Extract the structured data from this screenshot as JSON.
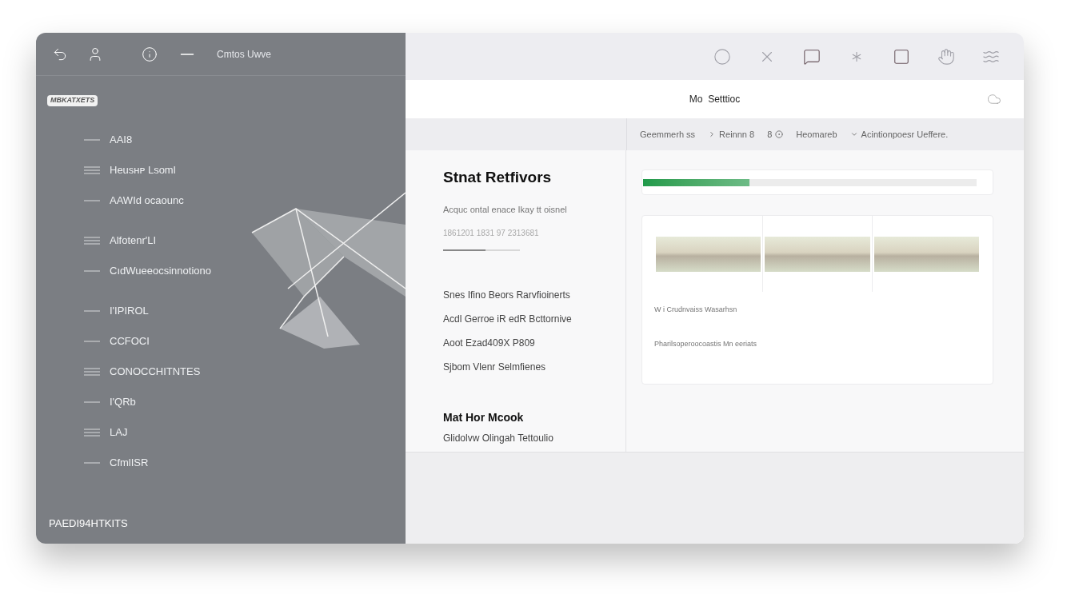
{
  "sidebar": {
    "toolbar_label": "Cmtos Uwve",
    "badge": "MBKATXETS",
    "items": [
      {
        "label": "AAI8"
      },
      {
        "label": "Heusʜᴘ Lsoml"
      },
      {
        "label": "AAWId ocaounc"
      },
      {
        "label": "Alfotenr'LI"
      },
      {
        "label": "CıdWueeocsinnotiono"
      },
      {
        "label": "I'IPIROL"
      },
      {
        "label": "CCFOCI"
      },
      {
        "label": "CONOCCHITNTES"
      },
      {
        "label": "I'QRb"
      },
      {
        "label": "LAJ"
      },
      {
        "label": "CfmlISR"
      }
    ],
    "footer": "PAEDI94HTKITS"
  },
  "header": {
    "title": "Mo  Setttioc"
  },
  "filters": [
    "Geemmerh ss",
    "Reinnn 8",
    "8",
    "Heomareb",
    "Acintionpoesr Ueffere."
  ],
  "summary": {
    "title": "Stnat Retfivors",
    "subtitle": "Acquc ontal enace Ikay tt oisnel",
    "numbers": "1861201 1831 97 2313681",
    "level": 0.55,
    "links": [
      "Snes Ifino Beors Rarvfioinerts",
      "Acdl Gerroe iR edR Bcttornive",
      "Aoot Ezad409X P809",
      "Sjbom Vlenr Selmfienes"
    ],
    "section_title": "Mat Hor Mcook",
    "section_text": "Glidolvw Olingah Tettoulio"
  },
  "preview": {
    "level": 0.32,
    "caption": "W i Crudnvaiss Wasarhsn",
    "note": "Pharilsoperoocoastis Mn eeriats"
  }
}
